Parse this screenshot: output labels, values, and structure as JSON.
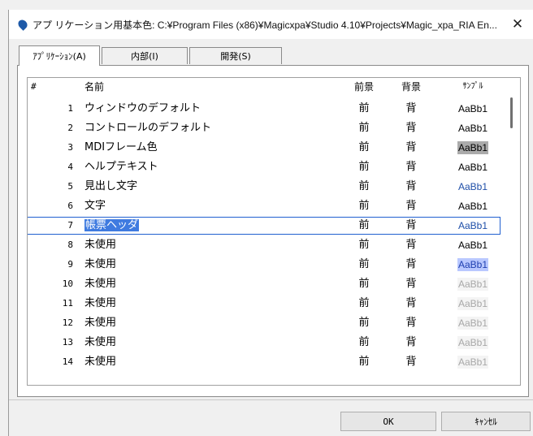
{
  "window": {
    "title": "アプ リケーション用基本色: C:¥Program Files (x86)¥Magicxpa¥Studio 4.10¥Projects¥Magic_xpa_RIA En...",
    "close_glyph": "✕"
  },
  "tabs": [
    {
      "label": "ｱﾌﾟﾘｹｰｼｮﾝ(A)",
      "active": true
    },
    {
      "label": "内部(I)",
      "active": false
    },
    {
      "label": "開発(S)",
      "active": false
    }
  ],
  "table": {
    "headers": {
      "num": "#",
      "name": "名前",
      "fg": "前景",
      "bg": "背景",
      "sample": "ｻﾝﾌﾟﾙ"
    },
    "rows": [
      {
        "num": "1",
        "name": "ウィンドウのデフォルト",
        "fg": "前",
        "bg": "背",
        "sample": "AaBb1",
        "sample_fg": "#000000",
        "sample_bg": "#ffffff"
      },
      {
        "num": "2",
        "name": "コントロールのデフォルト",
        "fg": "前",
        "bg": "背",
        "sample": "AaBb1",
        "sample_fg": "#000000",
        "sample_bg": "#ffffff"
      },
      {
        "num": "3",
        "name": "MDIフレーム色",
        "fg": "前",
        "bg": "背",
        "sample": "AaBb1",
        "sample_fg": "#000000",
        "sample_bg": "#ababab"
      },
      {
        "num": "4",
        "name": "ヘルプテキスト",
        "fg": "前",
        "bg": "背",
        "sample": "AaBb1",
        "sample_fg": "#000000",
        "sample_bg": "#ffffff"
      },
      {
        "num": "5",
        "name": "見出し文字",
        "fg": "前",
        "bg": "背",
        "sample": "AaBb1",
        "sample_fg": "#1f4fa8",
        "sample_bg": "#ffffff"
      },
      {
        "num": "6",
        "name": "文字",
        "fg": "前",
        "bg": "背",
        "sample": "AaBb1",
        "sample_fg": "#000000",
        "sample_bg": "#ffffff"
      },
      {
        "num": "7",
        "name": "帳票ヘッダ",
        "fg": "前",
        "bg": "背",
        "sample": "AaBb1",
        "sample_fg": "#1f4fa8",
        "sample_bg": "#ffffff",
        "selected": true
      },
      {
        "num": "8",
        "name": "未使用",
        "fg": "前",
        "bg": "背",
        "sample": "AaBb1",
        "sample_fg": "#000000",
        "sample_bg": "#ffffff"
      },
      {
        "num": "9",
        "name": "未使用",
        "fg": "前",
        "bg": "背",
        "sample": "AaBb1",
        "sample_fg": "#1f3fb0",
        "sample_bg": "#b9c8ff"
      },
      {
        "num": "10",
        "name": "未使用",
        "fg": "前",
        "bg": "背",
        "sample": "AaBb1",
        "sample_fg": "#a8a8a8",
        "sample_bg": "#f4f4f4"
      },
      {
        "num": "11",
        "name": "未使用",
        "fg": "前",
        "bg": "背",
        "sample": "AaBb1",
        "sample_fg": "#a8a8a8",
        "sample_bg": "#f4f4f4"
      },
      {
        "num": "12",
        "name": "未使用",
        "fg": "前",
        "bg": "背",
        "sample": "AaBb1",
        "sample_fg": "#a8a8a8",
        "sample_bg": "#f4f4f4"
      },
      {
        "num": "13",
        "name": "未使用",
        "fg": "前",
        "bg": "背",
        "sample": "AaBb1",
        "sample_fg": "#a8a8a8",
        "sample_bg": "#f4f4f4"
      },
      {
        "num": "14",
        "name": "未使用",
        "fg": "前",
        "bg": "背",
        "sample": "AaBb1",
        "sample_fg": "#a8a8a8",
        "sample_bg": "#f4f4f4"
      }
    ]
  },
  "buttons": {
    "ok": "OK",
    "cancel": "ｷｬﾝｾﾙ"
  },
  "colors": {
    "selection_border": "#2060d0",
    "selection_fill": "#3f7be0"
  }
}
